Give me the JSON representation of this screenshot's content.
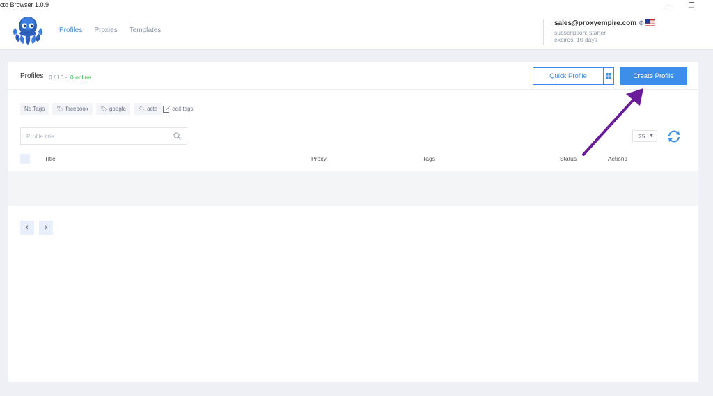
{
  "window": {
    "title": "cto Browser 1.0.9",
    "minimize": "—",
    "restore": "❐"
  },
  "nav": {
    "profiles": "Profiles",
    "proxies": "Proxies",
    "templates": "Templates"
  },
  "account": {
    "email": "sales@proxyempire.com",
    "subscription": "subscription: starter",
    "expires": "expires: 10 days"
  },
  "panel": {
    "title": "Profiles",
    "count": "0 / 10 -",
    "online": "0 online",
    "quick_profile": "Quick Profile",
    "create_profile": "Create Profile"
  },
  "tags": {
    "no_tags": "No Tags",
    "items": [
      "facebook",
      "google",
      "octo"
    ],
    "edit": "edit tags"
  },
  "search": {
    "placeholder": "Profile title"
  },
  "perpage": {
    "value": "25"
  },
  "table": {
    "columns": {
      "title": "Title",
      "proxy": "Proxy",
      "tags": "Tags",
      "status": "Status",
      "actions": "Actions"
    }
  },
  "pager": {
    "prev": "‹",
    "next": "›"
  },
  "colors": {
    "accent": "#3d8eea",
    "online": "#2fb344",
    "annotation_arrow": "#6a1b9a"
  },
  "icons": [
    "octopus-logo-icon",
    "gear-icon",
    "us-flag-icon",
    "windows-icon",
    "tag-icon",
    "edit-icon",
    "search-icon",
    "refresh-icon",
    "chevron-down-icon",
    "chevron-left-icon",
    "chevron-right-icon"
  ]
}
